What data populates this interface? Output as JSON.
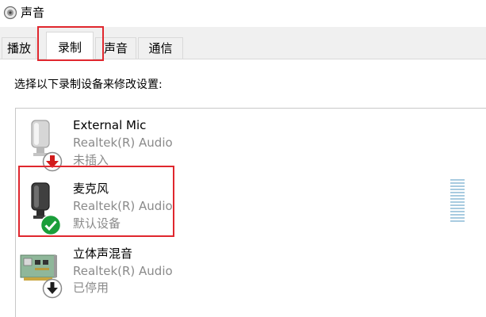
{
  "window": {
    "title": "声音"
  },
  "tabs": [
    {
      "label": "播放"
    },
    {
      "label": "录制"
    },
    {
      "label": "声音"
    },
    {
      "label": "通信"
    }
  ],
  "active_tab": "录制",
  "instruction": "选择以下录制设备来修改设置:",
  "devices": [
    {
      "name": "External Mic",
      "driver": "Realtek(R) Audio",
      "status": "未插入",
      "status_icon": "red-down-arrow-icon"
    },
    {
      "name": "麦克风",
      "driver": "Realtek(R) Audio",
      "status": "默认设备",
      "status_icon": "green-check-icon"
    },
    {
      "name": "立体声混音",
      "driver": "Realtek(R) Audio",
      "status": "已停用",
      "status_icon": "black-down-arrow-icon"
    }
  ],
  "colors": {
    "highlight": "#e0272e",
    "level": "#a8cbe0",
    "check": "#1a9e3a",
    "unplugged": "#d11b1b"
  }
}
